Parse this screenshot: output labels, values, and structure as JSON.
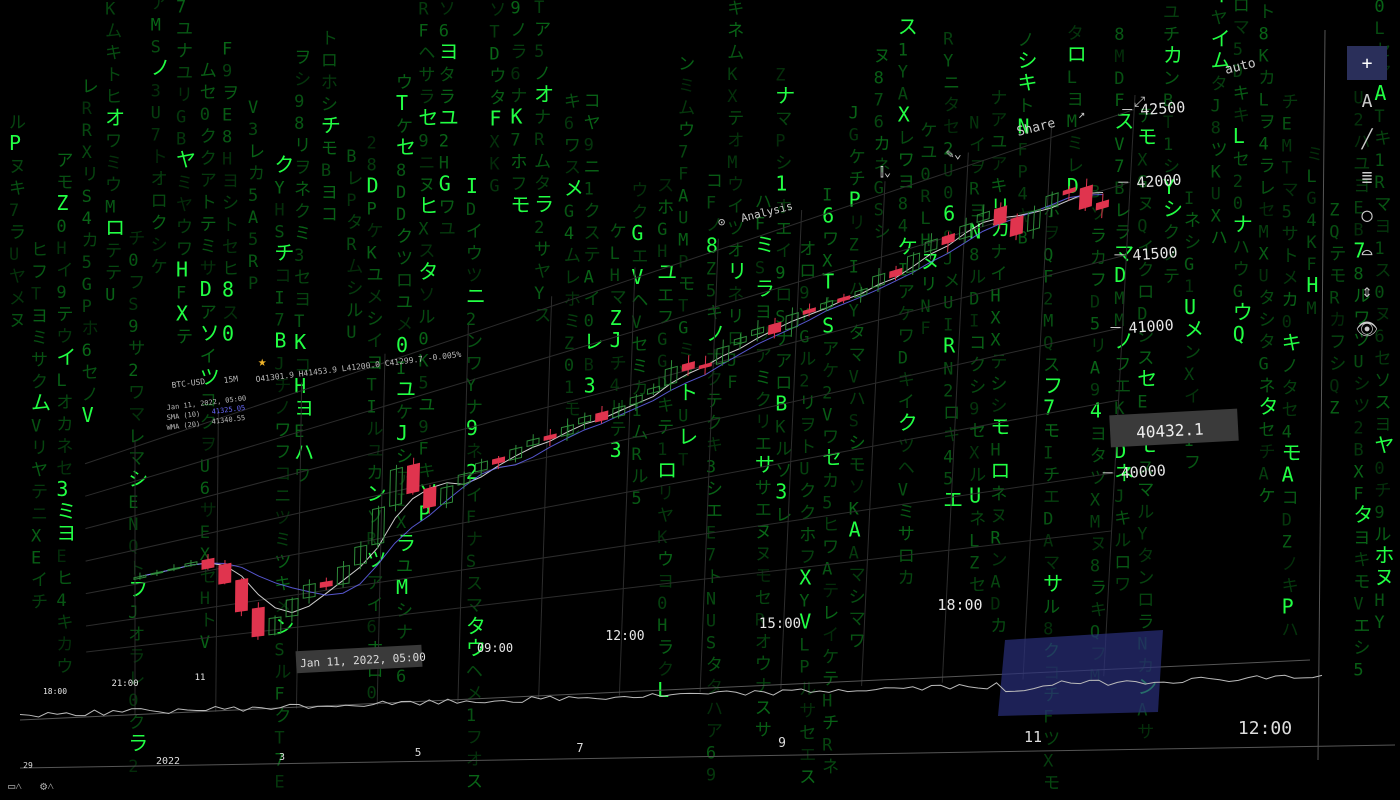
{
  "theme": {
    "bg": "#000000",
    "rain_bright": "#22ff44",
    "rain_dim": "#0b7a1c",
    "up": "#2e8b3a",
    "down": "#e0344e",
    "sma": "#ffffff",
    "wma": "#6a6aff",
    "highlight": "#2a2f7a"
  },
  "rain_glyphs": "アイウエオカキクケコサシスセソタチツテトナニヌネノハヒフヘホマミムメモヤユヨラリルレロワヲン0123456789ABDEFGHIJKLMNPQRSTUVXYZ",
  "header": {
    "symbol": "BTC-USD",
    "interval": "15M",
    "ohlc": "O41301.9  H41453.9  L41200.0  C41299.7  -0.005%",
    "crosshair_date": "Jan 11, 2022, 05:00",
    "sma_label": "SMA (10)",
    "sma_value": "41325.05",
    "wma_label": "WMA (20)",
    "wma_value": "41340.55"
  },
  "toolbar_top": {
    "analysis": "Analysis",
    "share": "Share",
    "auto": "auto"
  },
  "price_tag": "40432.1",
  "date_tag": "Jan 11, 2022, 05:00",
  "y_ticks": [
    "40000",
    "41000",
    "41500",
    "42000",
    "42500"
  ],
  "x_ticks": [
    "18:00",
    "21:00",
    "11",
    "09:00",
    "12:00",
    "15:00",
    "18:00"
  ],
  "nav_ticks": [
    "29",
    "2022",
    "3",
    "5",
    "7",
    "9",
    "11",
    "12:00"
  ],
  "chart_data": {
    "type": "candlestick",
    "title": "",
    "symbol": "BTC-USD",
    "interval": "15M",
    "y_axis_ticks": [
      40000,
      41000,
      41500,
      42000,
      42500
    ],
    "ylim": [
      39400,
      42600
    ],
    "x_axis_ticks": [
      "18:00",
      "21:00",
      "11",
      "09:00",
      "12:00",
      "15:00",
      "18:00"
    ],
    "ohlc_readout": {
      "open": 41301.9,
      "high": 41453.9,
      "low": 41200.0,
      "close": 41299.7,
      "change_pct": -0.005
    },
    "series": [
      {
        "name": "SMA (10)",
        "last": 41325.05
      },
      {
        "name": "WMA (20)",
        "last": 41340.55
      }
    ],
    "approx_close_path": [
      40600,
      40610,
      40620,
      40650,
      40540,
      40300,
      39900,
      39550,
      39750,
      39950,
      40100,
      40050,
      40250,
      40450,
      40850,
      41250,
      40950,
      40750,
      40920,
      41020,
      41100,
      41060,
      41160,
      41210,
      41180,
      41260,
      41310,
      41240,
      41320,
      41380,
      41420,
      41560,
      41510,
      41490,
      41620,
      41660,
      41700,
      41630,
      41740,
      41720,
      41760,
      41740,
      41780,
      41860,
      41820,
      41940,
      42010,
      41960,
      42050,
      42100,
      41990,
      41870,
      42000,
      42080,
      42060,
      41920,
      41880
    ],
    "legend": "none",
    "grid": true
  }
}
